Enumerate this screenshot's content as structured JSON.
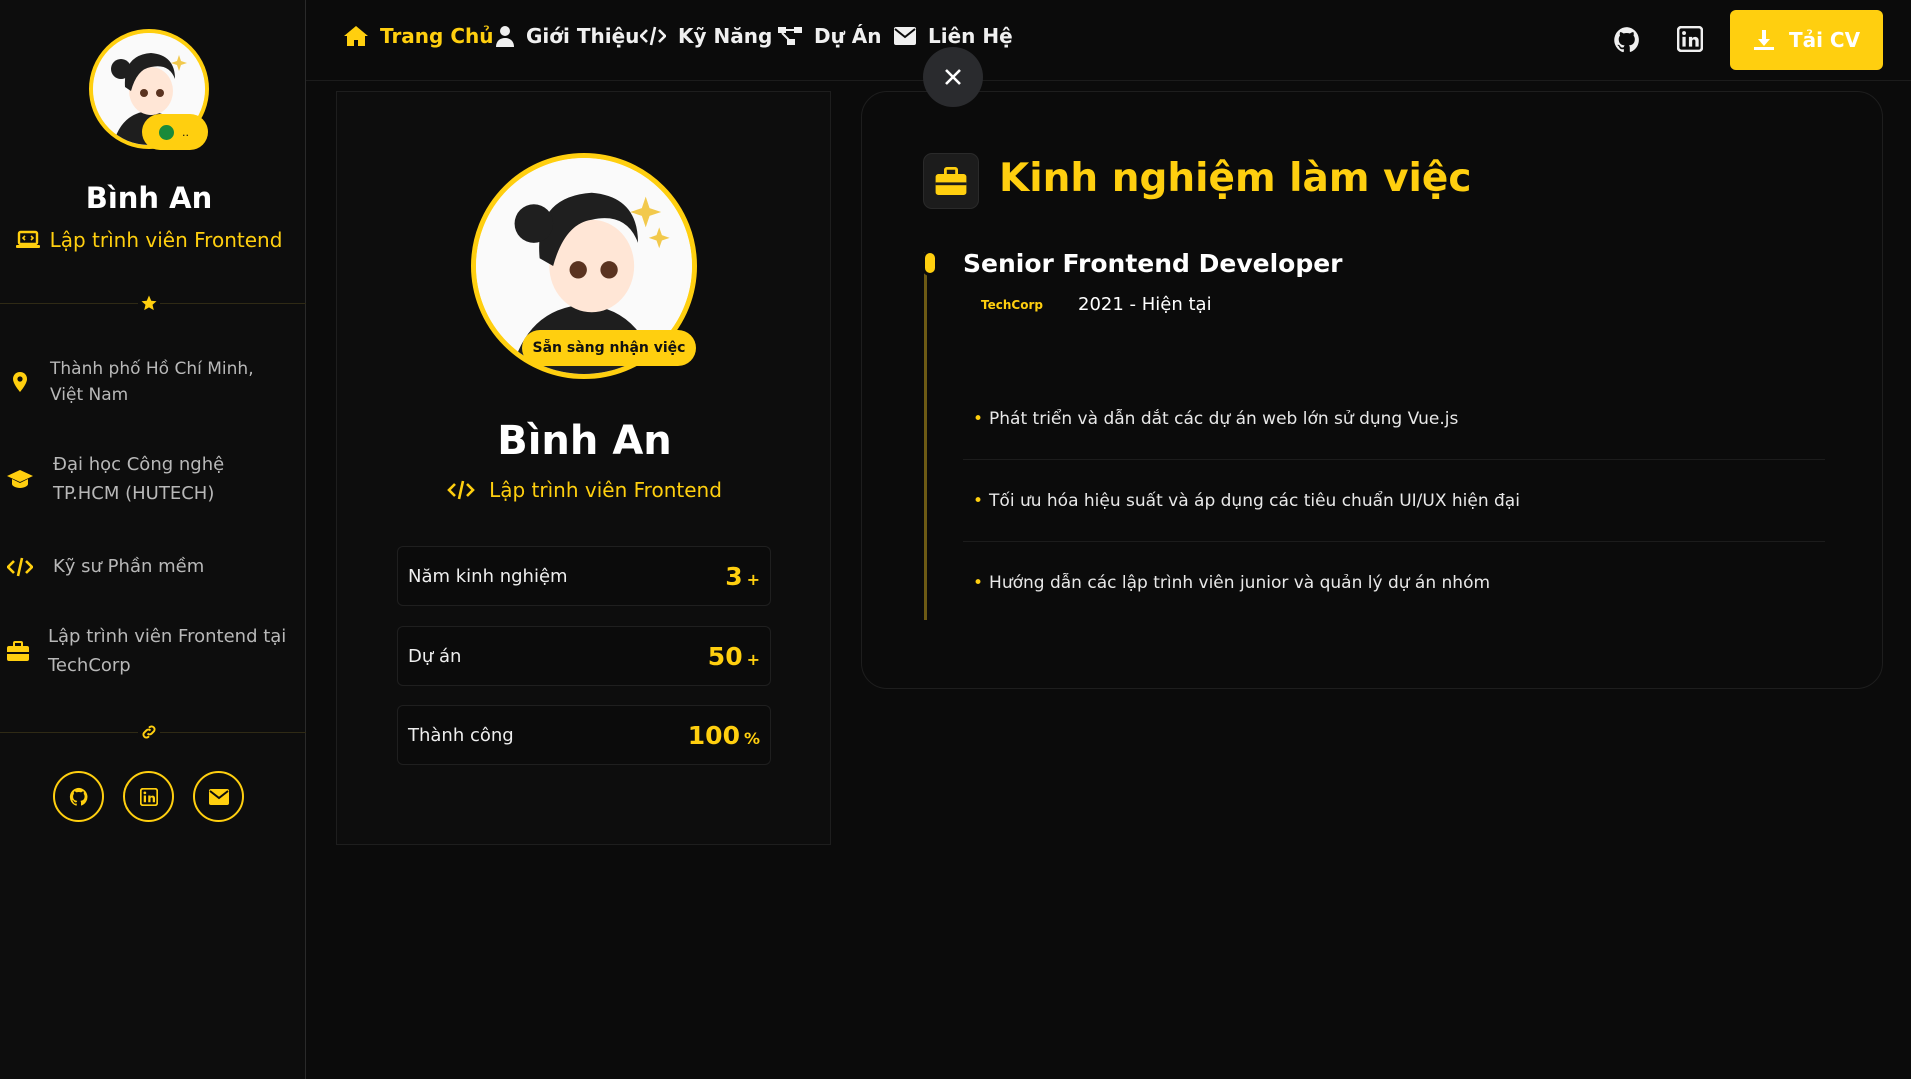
{
  "colors": {
    "accent": "#ffcf0f",
    "background": "#0b0b0b",
    "status_online": "#1a8a3a"
  },
  "sidebar": {
    "name": "Bình An",
    "role": "Lập trình viên Frontend",
    "status_dots": "..",
    "info": [
      {
        "icon": "location-pin-icon",
        "text": "Thành phố Hồ Chí Minh, Việt Nam"
      },
      {
        "icon": "graduation-cap-icon",
        "text": "Đại học Công nghệ TP.HCM (HUTECH)"
      },
      {
        "icon": "code-icon",
        "text": "Kỹ sư Phần mềm"
      },
      {
        "icon": "briefcase-icon",
        "text": "Lập trình viên Frontend tại TechCorp"
      }
    ],
    "social": [
      "github-icon",
      "linkedin-icon",
      "envelope-icon"
    ]
  },
  "nav": {
    "items": [
      {
        "icon": "home-icon",
        "label": "Trang Chủ",
        "active": true
      },
      {
        "icon": "user-icon",
        "label": "Giới Thiệu"
      },
      {
        "icon": "code-icon",
        "label": "Kỹ Năng"
      },
      {
        "icon": "project-diagram-icon",
        "label": "Dự Án"
      },
      {
        "icon": "envelope-icon",
        "label": "Liên Hệ"
      }
    ],
    "cv_label": "Tải CV"
  },
  "profile": {
    "name": "Bình An",
    "role": "Lập trình viên Frontend",
    "badge": "Sẵn sàng nhận việc",
    "stats": [
      {
        "label": "Năm kinh nghiệm",
        "value": "3",
        "suffix": "+"
      },
      {
        "label": "Dự án",
        "value": "50",
        "suffix": "+"
      },
      {
        "label": "Thành công",
        "value": "100",
        "suffix": "%"
      }
    ]
  },
  "experience": {
    "title": "Kinh nghiệm làm việc",
    "job": {
      "title": "Senior Frontend Developer",
      "company": "TechCorp",
      "period": "2021 - Hiện tại",
      "bullets": [
        "Phát triển và dẫn dắt các dự án web lớn sử dụng Vue.js",
        "Tối ưu hóa hiệu suất và áp dụng các tiêu chuẩn UI/UX hiện đại",
        "Hướng dẫn các lập trình viên junior và quản lý dự án nhóm"
      ]
    }
  }
}
